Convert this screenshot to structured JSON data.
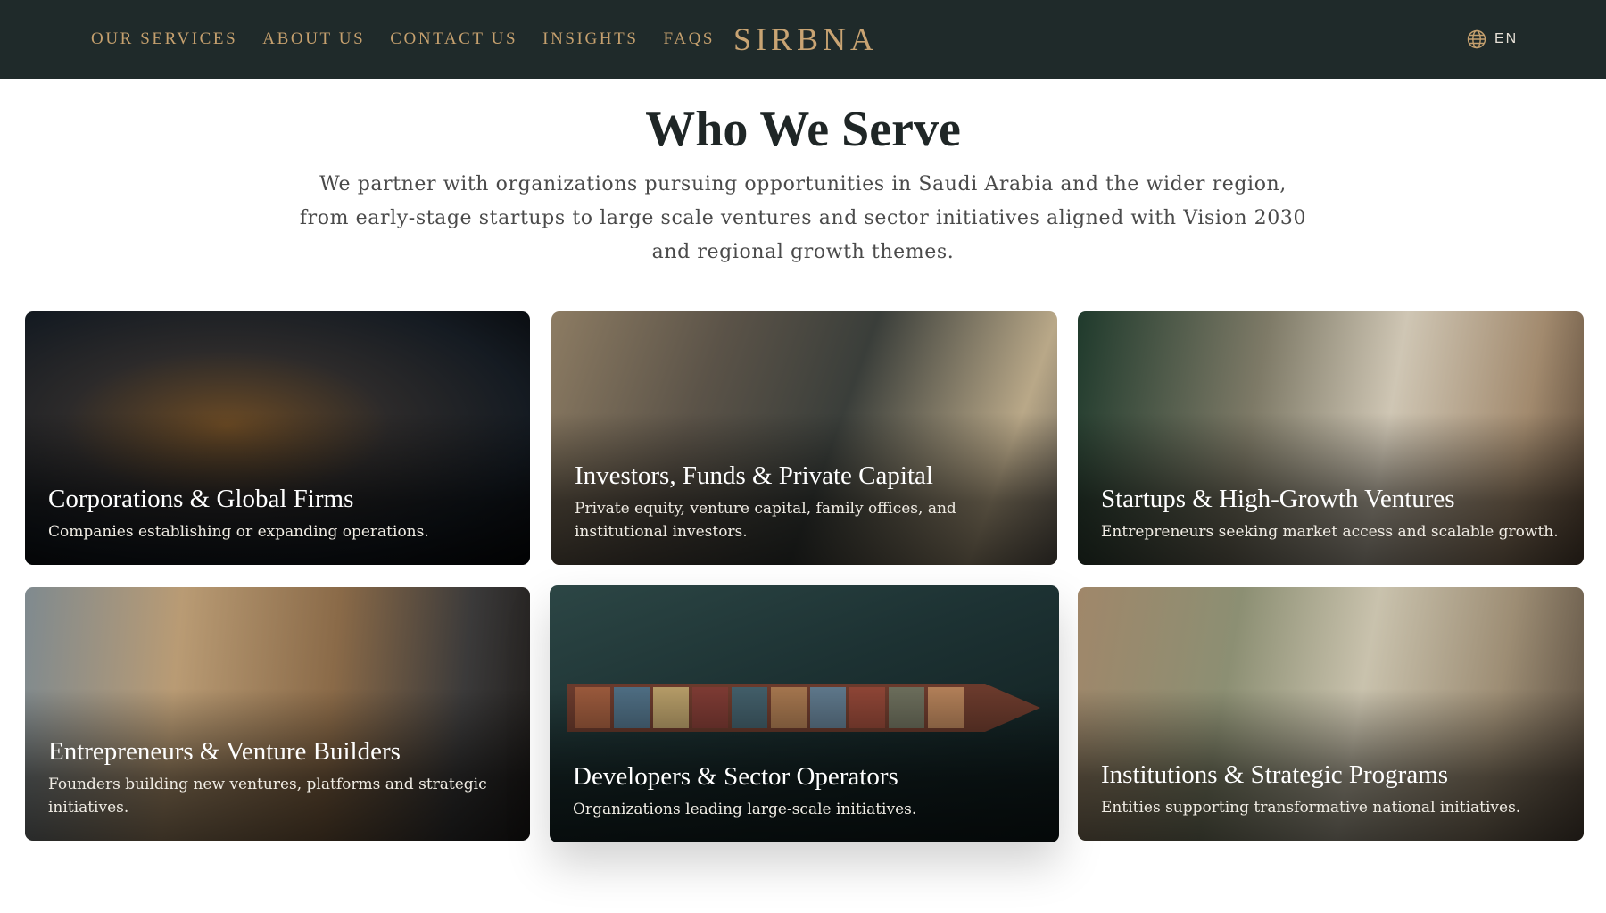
{
  "header": {
    "nav": [
      "OUR SERVICES",
      "ABOUT US",
      "CONTACT US",
      "INSIGHTS",
      "FAQS"
    ],
    "logo": "SIRBNA",
    "language": "EN"
  },
  "intro": {
    "title": "Who We Serve",
    "lead": "We partner with organizations pursuing opportunities in Saudi Arabia and the wider region, from early-stage startups to large scale ventures and sector initiatives aligned with Vision 2030 and regional growth themes."
  },
  "cards": [
    {
      "title": "Corporations & Global Firms",
      "description": "Companies establishing or expanding operations."
    },
    {
      "title": "Investors, Funds & Private Capital",
      "description": "Private equity, venture capital, family offices, and institutional investors."
    },
    {
      "title": "Startups & High-Growth Ventures",
      "description": "Entrepreneurs seeking market access and scalable growth."
    },
    {
      "title": "Entrepreneurs & Venture Builders",
      "description": "Founders building new ventures, platforms and strategic initiatives."
    },
    {
      "title": "Developers & Sector Operators",
      "description": "Organizations leading large-scale initiatives."
    },
    {
      "title": "Institutions & Strategic Programs",
      "description": "Entities supporting transformative national initiatives."
    }
  ],
  "icons": {
    "language": "globe-icon"
  },
  "colors": {
    "header_bg": "#1f2a2a",
    "accent_gold": "#c5a06e",
    "title": "#1f2626"
  }
}
